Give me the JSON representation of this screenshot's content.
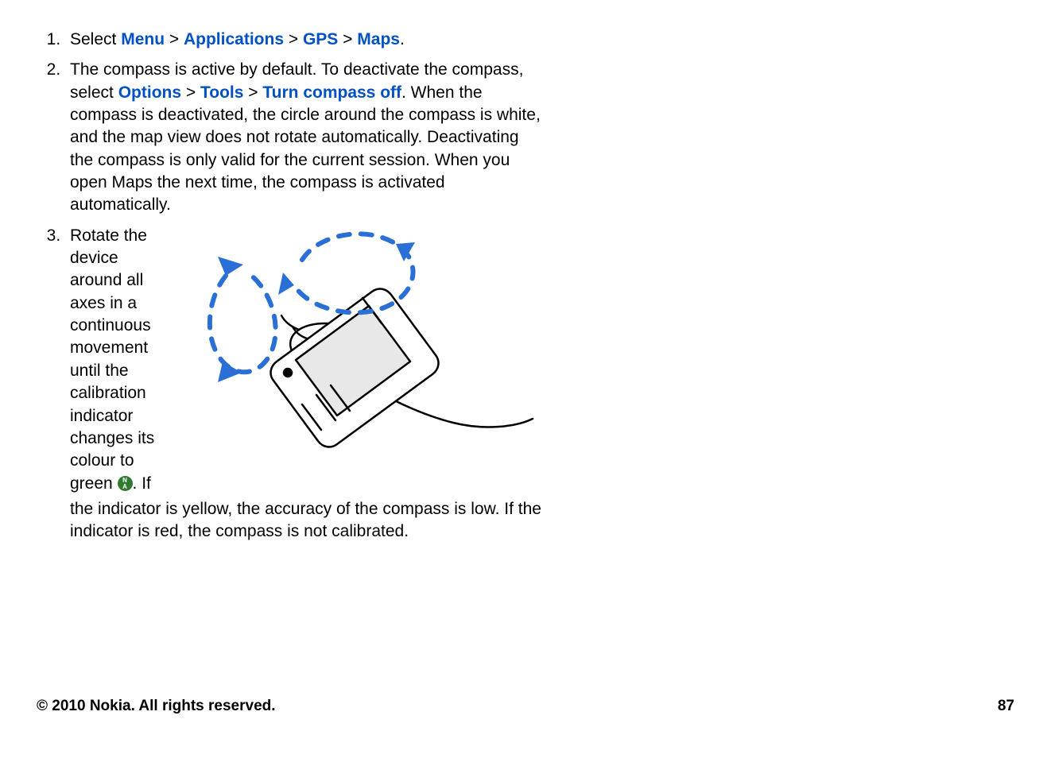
{
  "steps": {
    "s1": {
      "prefix": "Select ",
      "menu": "Menu",
      "applications": "Applications",
      "gps": "GPS",
      "maps": "Maps",
      "sep": " > ",
      "end": "."
    },
    "s2": {
      "part_a": "The compass is active by default. To deactivate the compass, select ",
      "options": "Options",
      "tools": "Tools",
      "turn_off": "Turn compass off",
      "sep": " > ",
      "part_b": ". When the compass is deactivated, the circle around the compass is white, and the map view does not rotate automatically. Deactivating the compass is only valid for the current session. When you open Maps the next time, the compass is activated automatically."
    },
    "s3": {
      "narrow": "Rotate the device around all axes in a continuous movement until the calibration indicator changes its colour to green ",
      "after_icon": ". If",
      "wide": "the indicator is yellow, the accuracy of the compass is low. If the indicator is red, the compass is not calibrated."
    }
  },
  "compass_icon": {
    "top": "N",
    "bottom": "A"
  },
  "footer": {
    "copyright": "© 2010 Nokia. All rights reserved.",
    "page_number": "87"
  }
}
